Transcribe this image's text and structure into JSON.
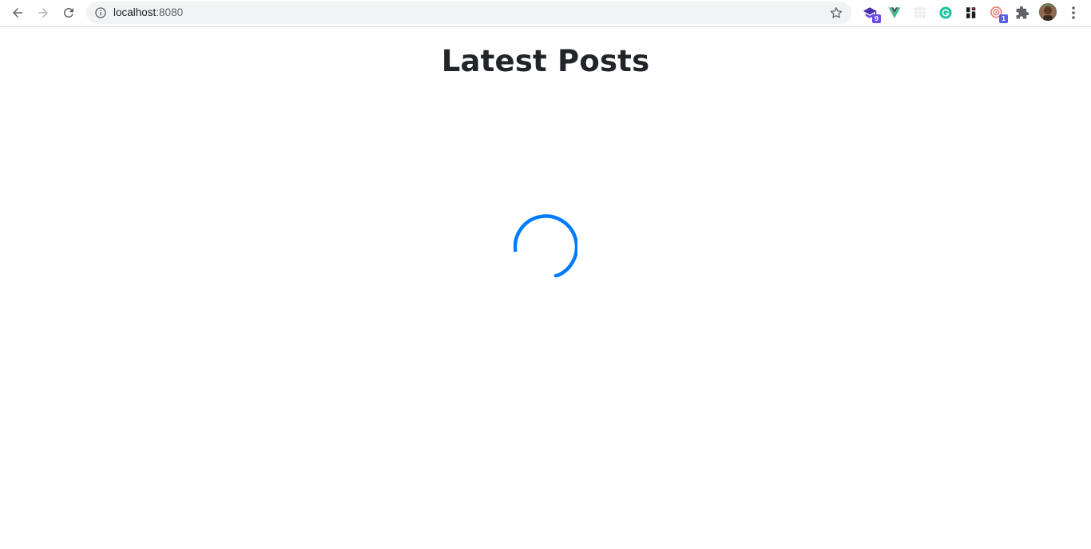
{
  "browser": {
    "url_host": "localhost",
    "url_port": ":8080",
    "extensions": [
      {
        "name": "cap-extension",
        "badge": "9",
        "badge_color": "#6b4de0",
        "color": "#4a2fb0"
      },
      {
        "name": "vue-devtools",
        "color": "#41b883"
      },
      {
        "name": "grid-extension",
        "color": "#d9d9d9"
      },
      {
        "name": "grammarly",
        "color": "#15c39a"
      },
      {
        "name": "tiles-extension",
        "color": "#1a1a1a"
      },
      {
        "name": "target-extension",
        "badge": "1",
        "badge_color": "#5a5ee8",
        "color": "#e8736c"
      }
    ]
  },
  "page": {
    "title": "Latest Posts",
    "spinner_color": "#007bff"
  }
}
